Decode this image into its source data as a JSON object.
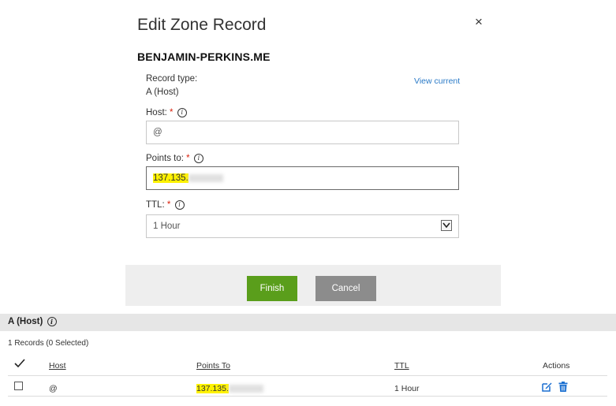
{
  "dialog": {
    "title": "Edit Zone Record",
    "close_glyph": "×",
    "domain": "BENJAMIN-PERKINS.ME",
    "record_type_label": "Record type:",
    "record_type_value": "A (Host)",
    "view_current": "View current",
    "host_label": "Host:",
    "host_value": "@",
    "points_to_label": "Points to:",
    "points_to_value": "137.135.",
    "ttl_label": "TTL:",
    "ttl_value": "1 Hour",
    "required_mark": "*",
    "info_glyph": "i",
    "finish_label": "Finish",
    "cancel_label": "Cancel"
  },
  "records": {
    "section_title": "A (Host)",
    "count_text": "1 Records (0 Selected)",
    "columns": {
      "host": "Host",
      "points_to": "Points To",
      "ttl": "TTL",
      "actions": "Actions"
    },
    "rows": [
      {
        "host": "@",
        "points_to": "137.135.",
        "ttl": "1 Hour"
      }
    ]
  },
  "colors": {
    "finish": "#5a9e1b",
    "cancel": "#8c8c8c",
    "link": "#2a7ac7",
    "highlight": "#fff200",
    "action_icon": "#1a6fd1"
  },
  "icons": [
    "close-icon",
    "info-icon",
    "chevron-down-icon",
    "checkmark-icon",
    "edit-icon",
    "trash-icon"
  ]
}
